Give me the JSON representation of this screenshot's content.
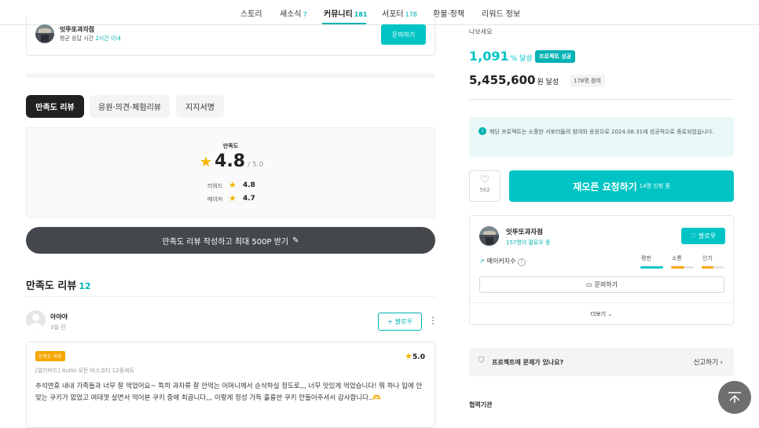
{
  "nav": {
    "tabs": [
      {
        "label": "스토리",
        "count": ""
      },
      {
        "label": "새소식",
        "count": "7"
      },
      {
        "label": "커뮤니티",
        "count": "181"
      },
      {
        "label": "서포터",
        "count": "178"
      },
      {
        "label": "환불·정책",
        "count": ""
      },
      {
        "label": "리워드 정보",
        "count": ""
      }
    ]
  },
  "maker_card": {
    "name": "잇뚜또과자점",
    "response_prefix": "평균 응답 시간",
    "response_time": "2시간 이내",
    "inquire_label": "문의하기"
  },
  "review_tabs": [
    "만족도 리뷰",
    "응원·의견·체험리뷰",
    "지지서명"
  ],
  "rating": {
    "title": "만족도",
    "score": "4.8",
    "of": "/ 5.0",
    "rows": [
      {
        "label": "리워드",
        "value": "4.8"
      },
      {
        "label": "메이커",
        "value": "4.7"
      }
    ]
  },
  "write_review_label": "만족도 리뷰 작성하고 최대 500P 받기",
  "reviews_section": {
    "title": "만족도 리뷰",
    "count": "12"
  },
  "review": {
    "author": "아야야",
    "date": "3일 전",
    "follow_label": "팔로우",
    "badge": "만족도 리뷰",
    "score": "5.0",
    "option": "[얼리버드] itutto 모든 비스코티 12종세트",
    "text": "추석연휴 내내 가족들과 너무 잘 먹었어요~ 특히 과자류 잘 안먹는 어머니께서 순삭하실 정도로,,, 너무 맛있게 먹었습니다! 뭐 하나 입에 안 맞는 쿠키가 없었고 여태껏 살면서 먹어본 쿠키 중에 최곱니다,,, 이렇게 정성 가득 훌륭한 쿠키 만들어주셔서 감사합니다..🫶"
  },
  "summary": {
    "share_text": "나보세요",
    "percent": "1,091",
    "percent_unit": "% 달성",
    "success_badge": "프로젝트 성공",
    "amount": "5,455,600",
    "amount_unit": "원 달성",
    "supporters_badge": "178명 참여"
  },
  "notice": {
    "icon_char": "i",
    "text": "해당 프로젝트는 소중한 서포터들의 참여와 응원으로 2024.08.31에 성공적으로 종료되었습니다."
  },
  "like": {
    "count": "562"
  },
  "reopen": {
    "label": "재오픈 요청하기",
    "sub": "14명 신청 중"
  },
  "maker_panel": {
    "name": "잇뚜또과자점",
    "followers": "157명이 팔로우 중",
    "follow_label": "팔로우",
    "index_label": "메이커지수",
    "metrics": [
      {
        "label": "평판",
        "fill": 1.0,
        "color": "#00c4c4"
      },
      {
        "label": "소통",
        "fill": 0.6,
        "color": "#f7a600"
      },
      {
        "label": "인기",
        "fill": 0.5,
        "color": "#f7a600"
      }
    ],
    "inquire_label": "문의하기",
    "more_label": "더보기"
  },
  "report": {
    "question": "프로젝트에 문제가 있나요?",
    "action": "신고하기"
  },
  "coop_label": "협력기관"
}
